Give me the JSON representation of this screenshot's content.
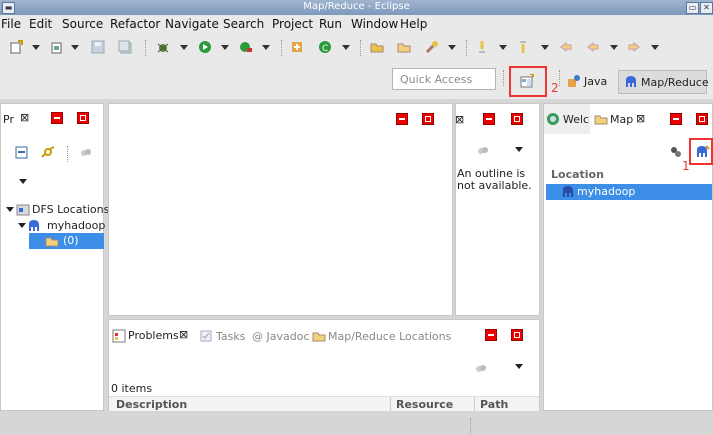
{
  "window": {
    "title": "Map/Reduce - Eclipse"
  },
  "menu": {
    "items": [
      {
        "label": "File"
      },
      {
        "label": "Edit"
      },
      {
        "label": "Source"
      },
      {
        "label": "Refactor"
      },
      {
        "label": "Navigate"
      },
      {
        "label": "Search"
      },
      {
        "label": "Project"
      },
      {
        "label": "Run"
      },
      {
        "label": "Window"
      },
      {
        "label": "Help"
      }
    ]
  },
  "quick_access": {
    "placeholder": "Quick Access"
  },
  "perspectives": {
    "java": "Java",
    "mapreduce": "Map/Reduce"
  },
  "annotations": {
    "one": "1",
    "two": "2"
  },
  "project_explorer": {
    "tab_label": "Pr",
    "tree": {
      "dfs": "DFS Locations",
      "myhadoop": "myhadoop",
      "child": "(0)"
    }
  },
  "outline": {
    "message_line1": "An outline is",
    "message_line2": "not available."
  },
  "bottom_panel": {
    "tabs": {
      "problems": "Problems",
      "tasks": "Tasks",
      "javadoc": "@ Javadoc",
      "mr_locations": "Map/Reduce Locations"
    },
    "items_count": "0 items",
    "columns": {
      "description": "Description",
      "resource": "Resource",
      "path": "Path"
    }
  },
  "right_panel": {
    "tabs": {
      "welcome": "Welc",
      "map": "Map"
    },
    "header": "Location",
    "location_item": "myhadoop"
  },
  "colors": {
    "selection": "#3d8ee6",
    "highlight": "#ee3333"
  }
}
